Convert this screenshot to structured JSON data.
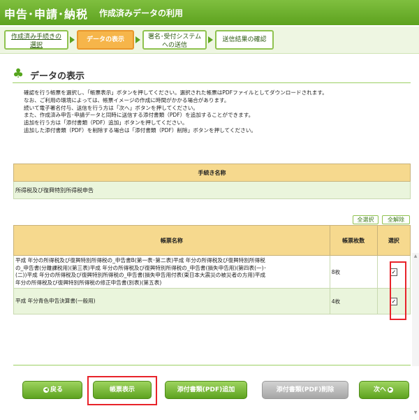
{
  "header": {
    "app_title": "申告･申請･納税",
    "subtitle": "作成済みデータの利用"
  },
  "steps": [
    {
      "line1": "作成済み手続きの",
      "line2": "選択"
    },
    {
      "label": "データの表示"
    },
    {
      "line1": "署名･受付システム",
      "line2": "への送信"
    },
    {
      "label": "送信結果の確認"
    }
  ],
  "section_title": "データの表示",
  "instructions": [
    "確認を行う帳票を選択し、「帳票表示」ボタンを押してください。選択された帳票はPDFファイルとしてダウンロードされます。",
    "なお、ご利用の環境によっては、帳票イメージの作成に時間がかかる場合があります。",
    "続いて電子署名付与、送信を行う方は「次へ」ボタンを押してください。",
    "また、作成済み申告･申請データと同時に送信する添付書類（PDF）を追加することができます。",
    "追加を行う方は「添付書類（PDF）追加」ボタンを押してください。",
    "追加した添付書類（PDF）を削除する場合は「添付書類（PDF）削除」ボタンを押してください。"
  ],
  "procedure_table": {
    "header": "手続き名称",
    "value": "所得税及び復興特別所得税申告"
  },
  "select_buttons": {
    "select_all": "全選択",
    "clear_all": "全解除"
  },
  "documents_table": {
    "headers": {
      "name": "帳票名称",
      "count": "帳票枚数",
      "select": "選択"
    },
    "rows": [
      {
        "name_lines": [
          "平成 年分の所得税及び復興特別所得税の_申告書B(第一表･第二表)平成 年分の所得税及び復興特別所得税",
          "の_申告書(分離課税用)(第三表)平成 年分の所得税及び復興特別所得税の_申告書(損失申告用)(第四表(一)･",
          "(二))平成 年分の所得税及び復興特別所得税の_申告書(損失申告用付表(東日本大震災の被災者の方用)平成",
          "年分の所得税及び復興特別所得税の修正申告書(別表)(第五表)"
        ],
        "count": "8枚",
        "checked": true
      },
      {
        "name_lines": [
          "平成 年分青色申告決算書(一般用)"
        ],
        "count": "4枚",
        "checked": true
      }
    ]
  },
  "buttons": {
    "back": "戻る",
    "show_docs": "帳票表示",
    "add_pdf": "添付書類(PDF)追加",
    "delete_pdf": "添付書類(PDF)削除",
    "next": "次へ"
  }
}
